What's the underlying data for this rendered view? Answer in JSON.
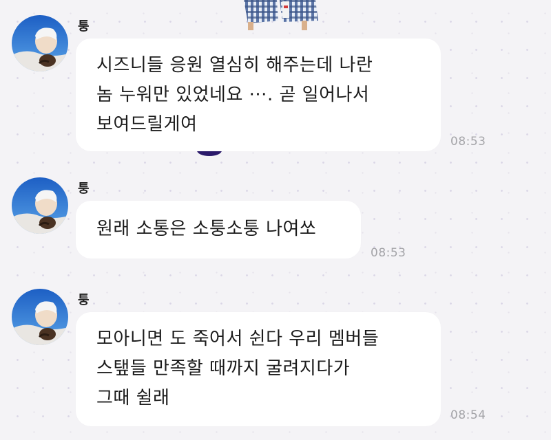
{
  "chat": {
    "messages": [
      {
        "sender": "퉁",
        "avatar_icon": "profile-photo",
        "lines": [
          "시즈니들 응원 열심히 해주는데 나란",
          "놈 누워만 있었네요 ···. 곧 일어나서",
          "보여드릴게여"
        ],
        "time": "08:53"
      },
      {
        "sender": "퉁",
        "avatar_icon": "profile-photo",
        "lines": [
          "원래 소통은 소퉁소퉁 나여쏘"
        ],
        "time": "08:53"
      },
      {
        "sender": "퉁",
        "avatar_icon": "profile-photo",
        "lines": [
          "모아니면 도 죽어서 쉰다 우리 멤버들",
          "스탶들 만족할 때까지 굴려지다가",
          "그때 쉴래"
        ],
        "time": "08:54"
      }
    ]
  },
  "colors": {
    "background": "#f4f3f6",
    "bubble": "#ffffff",
    "timestamp": "#a4a4a8",
    "text": "#1b1b1b"
  }
}
